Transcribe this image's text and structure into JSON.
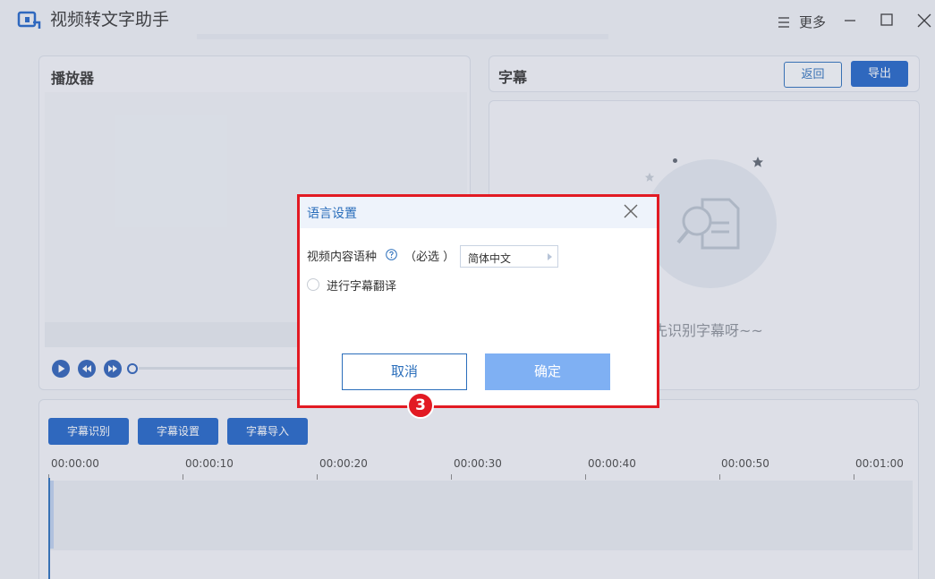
{
  "app": {
    "title": "视频转文字助手",
    "more_label": "更多"
  },
  "player": {
    "title": "播放器"
  },
  "subtitles": {
    "title": "字幕",
    "back_label": "返回",
    "export_label": "导出",
    "empty_text": "先识别字幕呀~~"
  },
  "timeline": {
    "buttons": [
      "字幕识别",
      "字幕设置",
      "字幕导入"
    ],
    "time_labels": [
      "00:00:00",
      "00:00:10",
      "00:00:20",
      "00:00:30",
      "00:00:40",
      "00:00:50",
      "00:01:00"
    ]
  },
  "dialog": {
    "title": "语言设置",
    "language_label": "视频内容语种",
    "required_hint": "（必选 ）",
    "language_value": "简体中文",
    "translate_label": "进行字幕翻译",
    "cancel_label": "取消",
    "ok_label": "确定"
  },
  "annotation": {
    "step_number": "3"
  },
  "colors": {
    "accent": "#1f63c7",
    "highlight": "#e21a23",
    "ok_disabled": "#7fb0f3"
  }
}
